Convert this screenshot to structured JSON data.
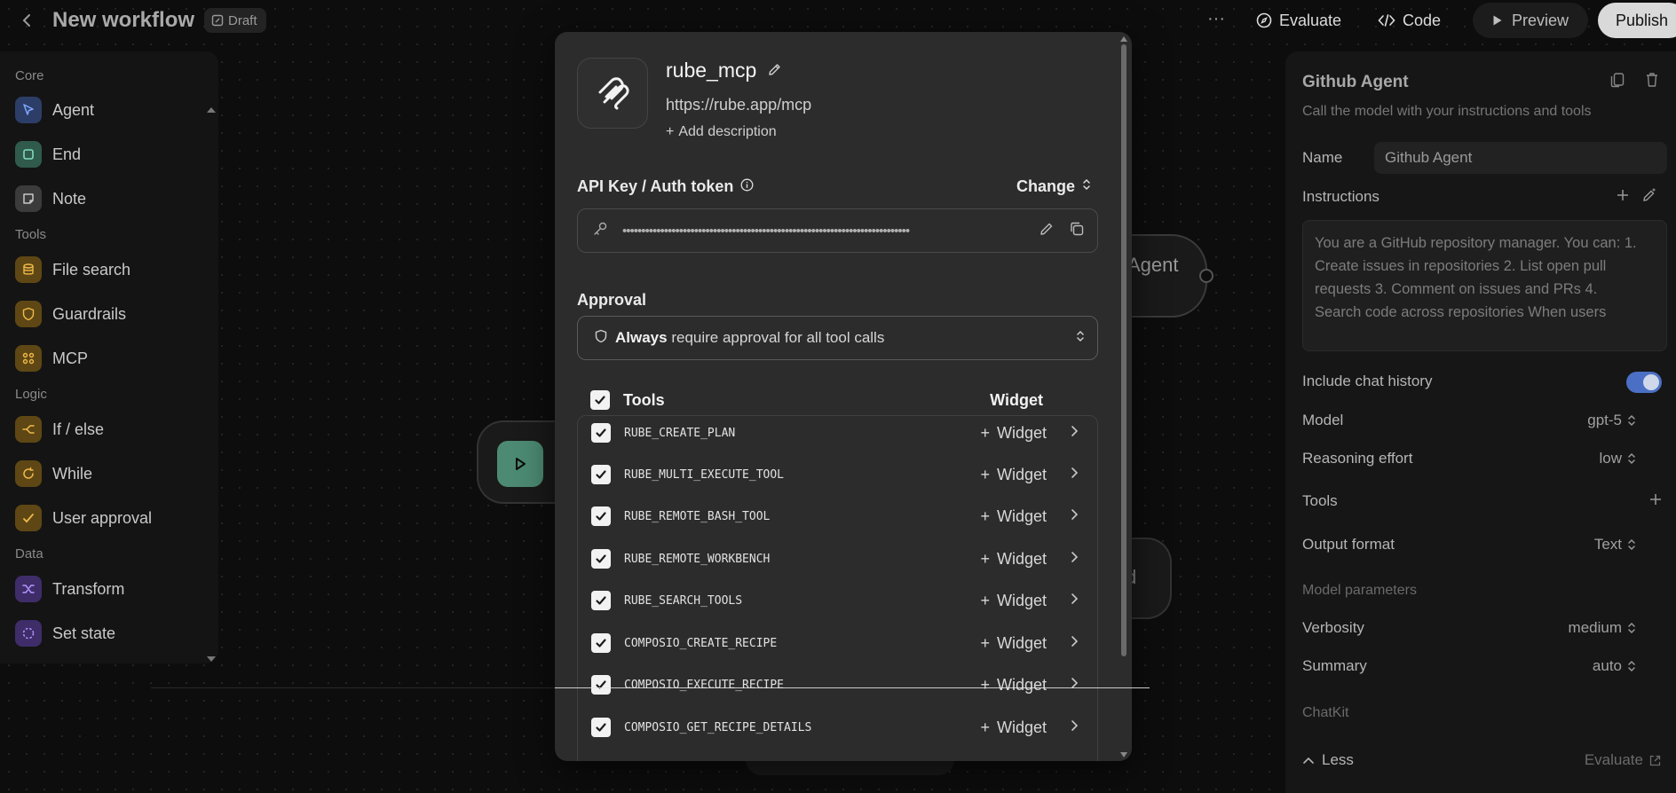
{
  "header": {
    "title": "New workflow",
    "draft_label": "Draft",
    "evaluate_label": "Evaluate",
    "code_label": "Code",
    "preview_label": "Preview",
    "publish_label": "Publish"
  },
  "sidebar": {
    "groups": {
      "core": "Core",
      "tools": "Tools",
      "logic": "Logic",
      "data": "Data"
    },
    "items": [
      {
        "label": "Agent",
        "icon": "cursor-icon",
        "color": "#7ea6ff"
      },
      {
        "label": "End",
        "icon": "stop-icon",
        "color": "#7fdcbd"
      },
      {
        "label": "Note",
        "icon": "note-icon",
        "color": "#c8c8c8"
      },
      {
        "label": "File search",
        "icon": "database-icon",
        "color": "#f0b94a"
      },
      {
        "label": "Guardrails",
        "icon": "shield-icon",
        "color": "#f0b94a"
      },
      {
        "label": "MCP",
        "icon": "mcp-icon",
        "color": "#f0b94a"
      },
      {
        "label": "If / else",
        "icon": "branch-icon",
        "color": "#f0b94a"
      },
      {
        "label": "While",
        "icon": "loop-icon",
        "color": "#f0b94a"
      },
      {
        "label": "User approval",
        "icon": "approval-icon",
        "color": "#f0b94a"
      },
      {
        "label": "Transform",
        "icon": "shuffle-icon",
        "color": "#b496ff"
      },
      {
        "label": "Set state",
        "icon": "state-icon",
        "color": "#b496ff"
      }
    ]
  },
  "canvas": {
    "agent_node_label": "Agent",
    "end_node_label": "d"
  },
  "modal": {
    "server_name": "rube_mcp",
    "server_url": "https://rube.app/mcp",
    "add_description": "Add description",
    "auth_label": "API Key / Auth token",
    "change_label": "Change",
    "token_mask": "••••••••••••••••••••••••••••••••••••••••••••••••••••••••••••••••••••••••••••",
    "approval_label": "Approval",
    "approval_strong": "Always",
    "approval_rest": "require approval for all tool calls",
    "tools_header": "Tools",
    "widget_header": "Widget",
    "widget_button": "Widget",
    "tools": [
      "RUBE_CREATE_PLAN",
      "RUBE_MULTI_EXECUTE_TOOL",
      "RUBE_REMOTE_BASH_TOOL",
      "RUBE_REMOTE_WORKBENCH",
      "RUBE_SEARCH_TOOLS",
      "COMPOSIO_CREATE_RECIPE",
      "COMPOSIO_EXECUTE_RECIPE",
      "COMPOSIO_GET_RECIPE_DETAILS"
    ]
  },
  "panel": {
    "title": "Github Agent",
    "subtitle": "Call the model with your instructions and tools",
    "name_label": "Name",
    "name_value": "Github Agent",
    "instructions_label": "Instructions",
    "instructions_text": "You are a GitHub repository manager. You can: 1. Create issues in repositories 2. List open pull requests 3. Comment on issues and PRs 4. Search code across repositories When users",
    "chat_history_label": "Include chat history",
    "chat_history_on": true,
    "model_label": "Model",
    "model_value": "gpt-5",
    "reasoning_label": "Reasoning effort",
    "reasoning_value": "low",
    "tools_label": "Tools",
    "output_label": "Output format",
    "output_value": "Text",
    "model_params_label": "Model parameters",
    "verbosity_label": "Verbosity",
    "verbosity_value": "medium",
    "summary_label": "Summary",
    "summary_value": "auto",
    "chatkit_label": "ChatKit",
    "less_label": "Less",
    "evaluate_label": "Evaluate"
  }
}
